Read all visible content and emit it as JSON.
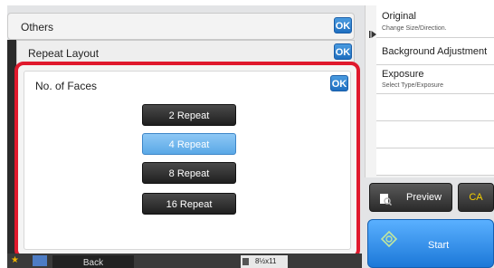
{
  "others_panel": {
    "title": "Others",
    "ok": "OK"
  },
  "repeat_layout_panel": {
    "title": "Repeat Layout",
    "ok": "OK"
  },
  "faces_dialog": {
    "title": "No. of Faces",
    "ok": "OK",
    "options": [
      "2 Repeat",
      "4 Repeat",
      "8 Repeat",
      "16 Repeat"
    ],
    "selected_index": 1
  },
  "right_panel": {
    "original": {
      "title": "Original",
      "subtitle": "Change Size/Direction."
    },
    "background": {
      "title": "Background Adjustment"
    },
    "exposure": {
      "title": "Exposure",
      "subtitle": "Select Type/Exposure"
    }
  },
  "actions": {
    "preview": "Preview",
    "ca": "CA",
    "start": "Start"
  },
  "bottom": {
    "back": "Back",
    "paper_size": "8½x11"
  },
  "colors": {
    "highlight_border": "#e0192d",
    "ok_blue": "#1f6fc0",
    "selected_option": "#5aa8e6",
    "ca_text": "#f5d000"
  }
}
